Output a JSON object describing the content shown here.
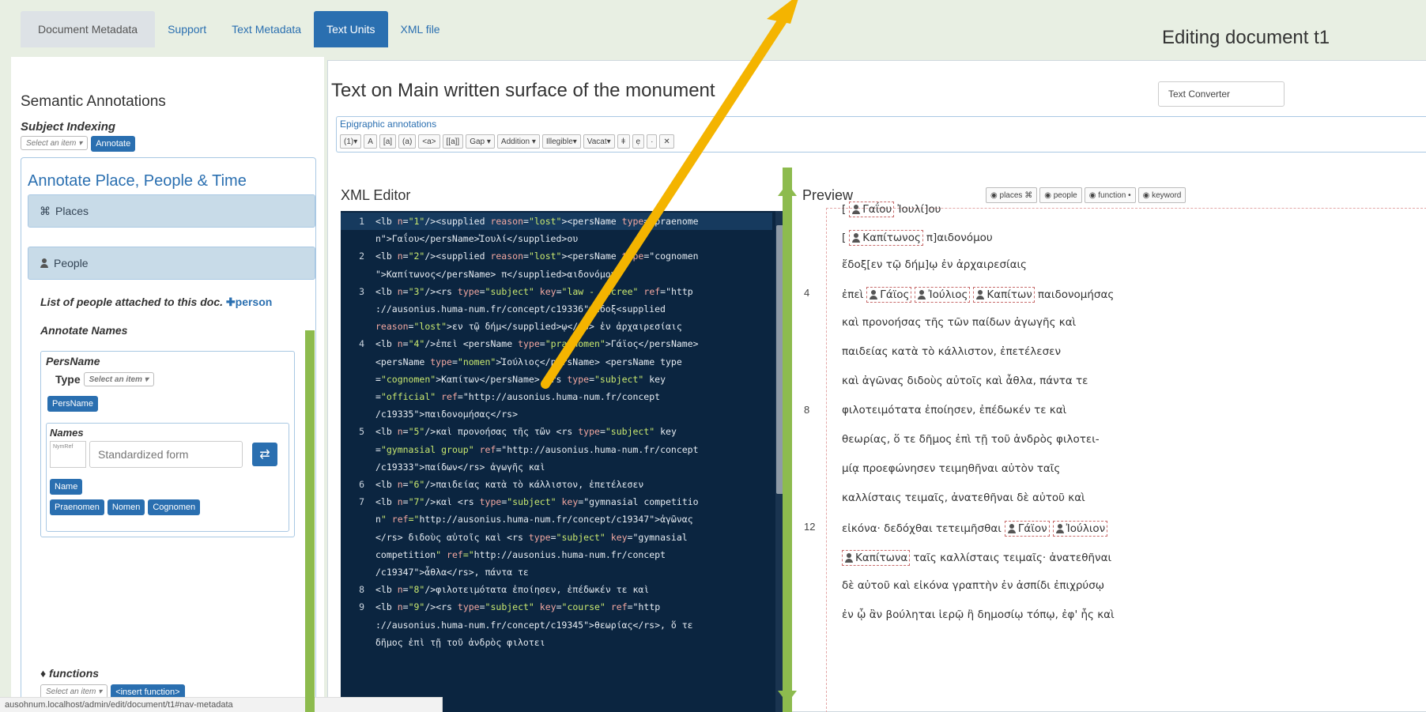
{
  "nav": {
    "tabs": [
      {
        "label": "Document Metadata"
      },
      {
        "label": "Support"
      },
      {
        "label": "Text Metadata"
      },
      {
        "label": "Text Units"
      },
      {
        "label": "XML file"
      }
    ],
    "active_tab": "Text Units"
  },
  "page_title": "Editing document t1",
  "left": {
    "semantic_title": "Semantic Annotations",
    "subject_title": "Subject Indexing",
    "subject_select": "Select an item",
    "annotate_button": "Annotate",
    "apt_title": "Annotate Place, People & Time",
    "places_label": "Places",
    "people_label": "People",
    "list_people": "List of people attached to this doc.",
    "add_person": "person",
    "annotate_names": "Annotate Names",
    "persname_title": "PersName",
    "type_label": "Type",
    "type_select": "Select an item",
    "persname_button": "PersName",
    "names_title": "Names",
    "nymref_placeholder": "NymRef",
    "standardized_placeholder": "Standardized form",
    "name_button": "Name",
    "praenomen_button": "Praenomen",
    "nomen_button": "Nomen",
    "cognomen_button": "Cognomen",
    "functions_title": "functions",
    "functions_select": "Select an item",
    "insert_function_button": "<insert function>"
  },
  "status_url": "ausohnum.localhost/admin/edit/document/t1#nav-metadata",
  "main": {
    "text_title": "Text on Main written surface of the monument",
    "converter_button": "Text Converter",
    "epi_title": "Epigraphic annotations",
    "epi_tools": [
      "(1)▾",
      "A",
      "[a]",
      "(a)",
      "<a>",
      "[[a]]",
      "Gap ▾",
      "Addition ▾",
      "Illegible▾",
      "Vacat▾",
      "ǂ",
      "ẹ",
      "·",
      "✕"
    ],
    "xml_title": "XML Editor",
    "xml_lines": [
      {
        "n": "1",
        "text": "<lb n=\"1\"/><supplied reason=\"lost\"><persName type=\"praenome"
      },
      {
        "n": "",
        "text": "n\">Γαΐου</persName>Ἰουλί</supplied>ου"
      },
      {
        "n": "2",
        "text": "<lb n=\"2\"/><supplied reason=\"lost\"><persName type=\"cognomen"
      },
      {
        "n": "",
        "text": "\">Καπίτωνος</persName> π</supplied>αιδονόμου"
      },
      {
        "n": "3",
        "text": "<lb n=\"3\"/><rs type=\"subject\" key=\"law - decree\" ref=\"http"
      },
      {
        "n": "",
        "text": "://ausonius.huma-num.fr/concept/c19336\">ἔδοξ<supplied"
      },
      {
        "n": "",
        "text": "reason=\"lost\">εν τῷ δήμ</supplied>ῳ</rs> ἐν ἀρχαιρεσίαις"
      },
      {
        "n": "4",
        "text": "<lb n=\"4\"/>ἐπεὶ <persName type=\"praenomen\">Γάϊος</persName>"
      },
      {
        "n": "",
        "text": "<persName type=\"nomen\">Ἰούλιος</persName> <persName type"
      },
      {
        "n": "",
        "text": "=\"cognomen\">Καπίτων</persName> <rs type=\"subject\" key"
      },
      {
        "n": "",
        "text": "=\"official\" ref=\"http://ausonius.huma-num.fr/concept"
      },
      {
        "n": "",
        "text": "/c19335\">παιδονομήσας</rs>"
      },
      {
        "n": "5",
        "text": "<lb n=\"5\"/>καὶ προνοήσας τῆς τῶν <rs type=\"subject\" key"
      },
      {
        "n": "",
        "text": "=\"gymnasial group\" ref=\"http://ausonius.huma-num.fr/concept"
      },
      {
        "n": "",
        "text": "/c19333\">παίδων</rs> ἀγωγῆς καὶ"
      },
      {
        "n": "6",
        "text": "<lb n=\"6\"/>παιδείας κατὰ τὸ κάλλιστον, ἐπετέλεσεν"
      },
      {
        "n": "7",
        "text": "<lb n=\"7\"/>καὶ <rs type=\"subject\" key=\"gymnasial competitio"
      },
      {
        "n": "",
        "text": "n\" ref=\"http://ausonius.huma-num.fr/concept/c19347\">ἀγῶνας"
      },
      {
        "n": "",
        "text": "</rs> διδοὺς αὐτοῖς καὶ <rs type=\"subject\" key=\"gymnasial"
      },
      {
        "n": "",
        "text": "competition\" ref=\"http://ausonius.huma-num.fr/concept"
      },
      {
        "n": "",
        "text": "/c19347\">ἆθλα</rs>, πάντα τε"
      },
      {
        "n": "8",
        "text": "<lb n=\"8\"/>φιλοτειμότατα ἐποίησεν, ἐπέδωκέν τε καὶ"
      },
      {
        "n": "9",
        "text": "<lb n=\"9\"/><rs type=\"subject\" key=\"course\" ref=\"http"
      },
      {
        "n": "",
        "text": "://ausonius.huma-num.fr/concept/c19345\">θεωρίας</rs>, ὅ τε"
      },
      {
        "n": "",
        "text": "δῆμος ἐπὶ τῇ τοῦ ἀνδρὸς φιλοτει"
      }
    ],
    "preview_title": "Preview",
    "preview_buttons": [
      "places ⌘",
      "people",
      "function •",
      "keyword"
    ],
    "preview_numbers": [
      "4",
      "8",
      "12"
    ],
    "preview": {
      "l1_a": "[",
      "l1_p": "Γαΐου",
      "l1_b": "Ἰουλί]ου",
      "l2_a": "[",
      "l2_p": "Καπίτωνος",
      "l2_b": "π]αιδονόμου",
      "l3": "ἔδοξ[εν τῷ δήμ]ῳ ἐν ἀρχαιρεσίαις",
      "l4_a": "ἐπεὶ",
      "l4_p1": "Γάϊος",
      "l4_p2": "Ἰούλιος",
      "l4_p3": "Καπίτων",
      "l4_b": "παιδονομήσας",
      "l5": "καὶ προνοήσας τῆς τῶν παίδων ἀγωγῆς καὶ",
      "l6": "παιδείας κατὰ τὸ κάλλιστον, ἐπετέλεσεν",
      "l7": "καὶ ἀγῶνας διδοὺς αὐτοῖς καὶ ἆθλα, πάντα τε",
      "l8": "φιλοτειμότατα ἐποίησεν, ἐπέδωκέν τε καὶ",
      "l9": "θεωρίας, ὅ τε δῆμος ἐπὶ τῇ τοῦ ἀνδρὸς φιλοτει-",
      "l10": "μίᾳ προεφώνησεν τειμηθῆναι αὐτὸν ταῖς",
      "l11": "καλλίσταις τειμαῖς, ἀνατεθῆναι δὲ αὐτοῦ καὶ",
      "l12_a": "εἰκόνα· δεδόχθαι τετειμῆσθαι",
      "l12_p1": "Γάϊον",
      "l12_p2": "Ἰούλιον",
      "l13_p": "Καπίτωνα",
      "l13_b": "ταῖς καλλίσταις τειμαῖς· ἀνατεθῆναι",
      "l14": "δὲ αὐτοῦ καὶ εἰκόνα γραπτὴν ἐν ἀσπίδι ἐπιχρύσῳ",
      "l15": "ἐν ᾧ ἂν βούληται ἱερῷ ἢ δημοσίῳ τόπῳ, ἐφ' ἧς καὶ"
    }
  },
  "colors": {
    "accent": "#2a6fb0",
    "annotation_arrow": "#f4b400",
    "annotation_bar": "#8dbb4e",
    "editor_bg": "#0b2540"
  }
}
